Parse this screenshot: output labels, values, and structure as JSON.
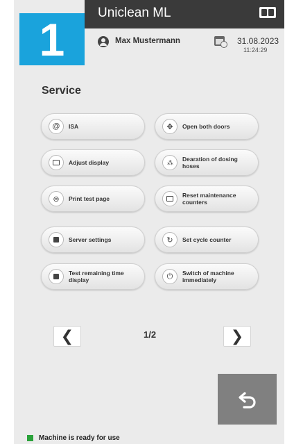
{
  "header": {
    "machine_number": "1",
    "app_title": "Uniclean ML",
    "user_name": "Max Mustermann",
    "date": "31.08.2023",
    "time": "11:24:29"
  },
  "section": {
    "title": "Service"
  },
  "buttons": [
    {
      "label": "ISA",
      "icon": "at-icon"
    },
    {
      "label": "Open both doors",
      "icon": "doors-icon"
    },
    {
      "label": "Adjust display",
      "icon": "display-icon"
    },
    {
      "label": "Dearation of dosing hoses",
      "icon": "dosing-icon"
    },
    {
      "label": "Print test page",
      "icon": "print-icon"
    },
    {
      "label": "Reset maintenance counters",
      "icon": "counter-reset-icon"
    },
    {
      "label": "Server settings",
      "icon": "server-icon"
    },
    {
      "label": "Set cycle counter",
      "icon": "cycle-counter-icon"
    },
    {
      "label": "Test remaining time display",
      "icon": "remaining-time-icon"
    },
    {
      "label": "Switch of machine immediately",
      "icon": "power-icon"
    }
  ],
  "pagination": {
    "indicator": "1/2",
    "prev_icon": "chevron-left-icon",
    "next_icon": "chevron-right-icon"
  },
  "back_button": {
    "icon": "back-arrow-icon"
  },
  "status": {
    "text": "Machine is ready for use",
    "color": "#2aa23a"
  },
  "colors": {
    "accent": "#1aa3dc",
    "top_bar": "#3a3a3a",
    "back_button": "#808080"
  }
}
